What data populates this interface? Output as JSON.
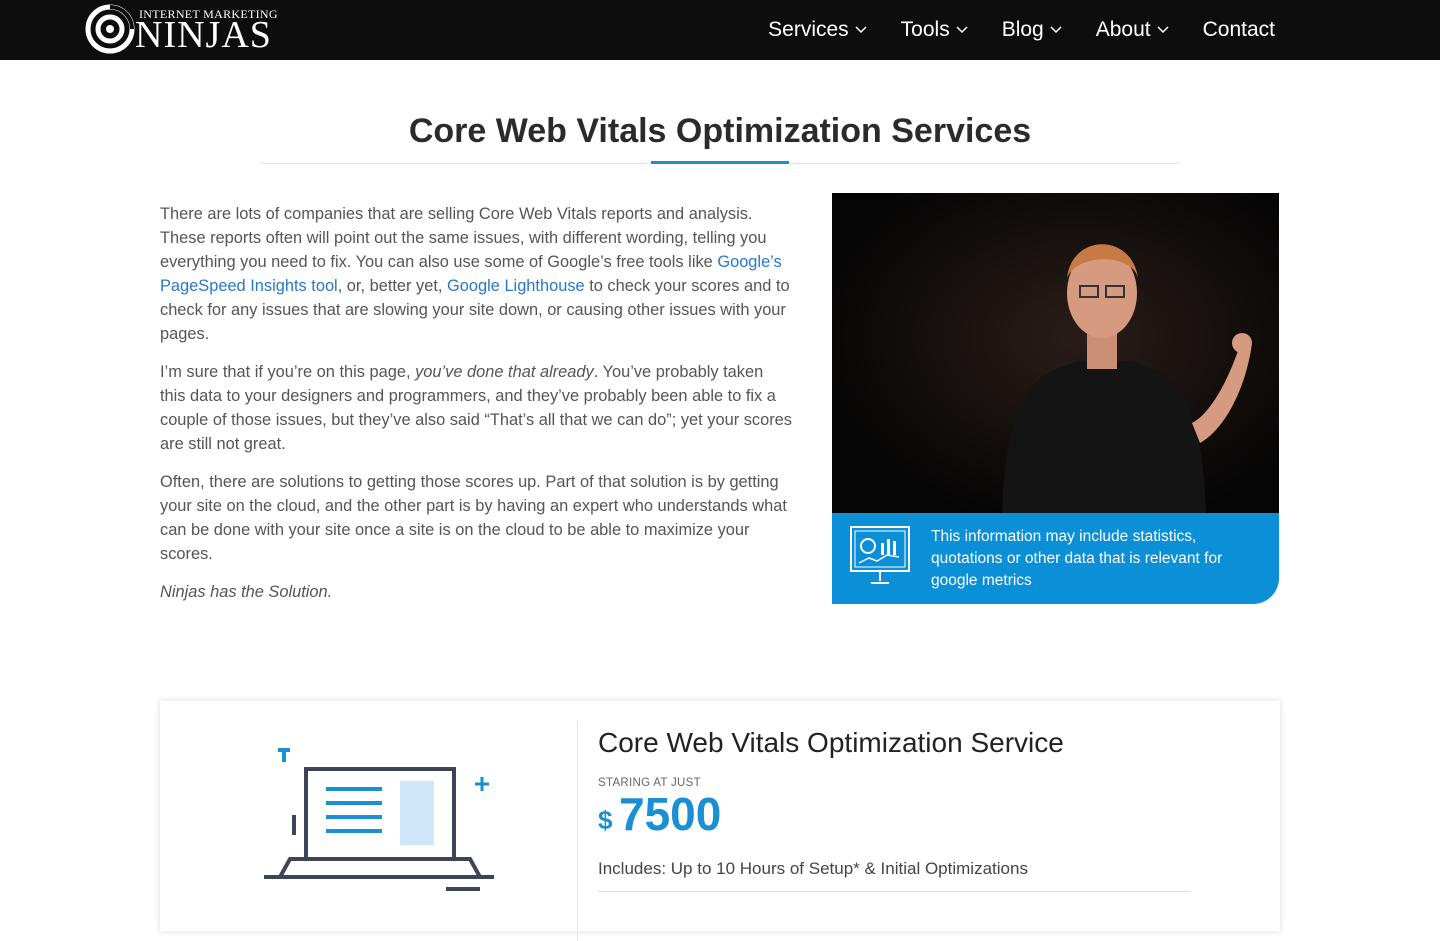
{
  "header": {
    "logo": {
      "top": "INTERNET MARKETING",
      "main": "NINJAS"
    },
    "nav": [
      {
        "label": "Services",
        "has_dropdown": true
      },
      {
        "label": "Tools",
        "has_dropdown": true
      },
      {
        "label": "Blog",
        "has_dropdown": true
      },
      {
        "label": "About",
        "has_dropdown": true
      },
      {
        "label": "Contact",
        "has_dropdown": false
      }
    ]
  },
  "main": {
    "title": "Core Web Vitals Optimization Services",
    "intro": {
      "p1": {
        "before": "There are lots of companies that are selling Core Web Vitals reports and analysis. These reports often will point out the same issues, with different wording, telling you everything you need to fix. You can also use some of Google’s free tools like ",
        "link1": "Google’s PageSpeed Insights tool",
        "middle": ", or, better yet, ",
        "link2": "Google Lighthouse",
        "after": " to check your scores and to check for any issues that are slowing your site down, or causing other issues with your pages."
      },
      "p2": {
        "before": "I’m sure that if you’re on this page, ",
        "emphasis": "you’ve done that already",
        "after": ". You’ve probably taken this data to your designers and programmers, and they’ve probably been able to fix a couple of those issues, but they’ve also said “That’s all that we can do”; yet your scores are still not great."
      },
      "p3": "Often, there are solutions to getting those scores up. Part of that solution is by getting your site on the cloud, and the other part is by having an expert who understands what can be done with your site once a site is on the cloud to be able to maximize your scores.",
      "p4": "Ninjas has the Solution."
    },
    "info_box": {
      "icon": "analytics-presentation-icon",
      "text": "This information may include statistics, quotations or other data that is relevant for google metrics"
    }
  },
  "pricing_card": {
    "icon": "laptop-icon",
    "title": "Core Web Vitals Optimization Service",
    "price_label": "STARING AT JUST",
    "currency": "$",
    "price": "7500",
    "includes": "Includes: Up to 10 Hours of Setup* & Initial Optimizations"
  },
  "colors": {
    "accent": "#1a8fd1",
    "link": "#2a77c9",
    "info_box": "#0b8fd6",
    "header_bg": "#0d0d0d"
  }
}
